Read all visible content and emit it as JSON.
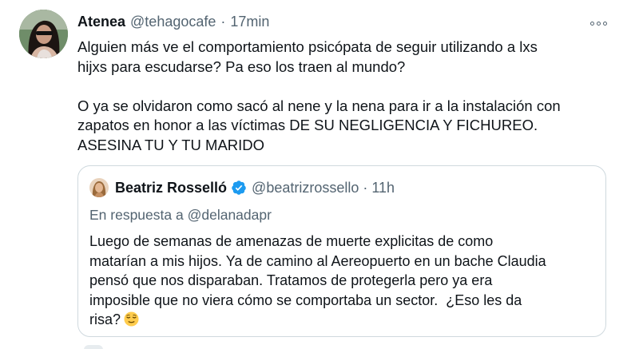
{
  "tweet": {
    "author_name": "Atenea",
    "author_handle": "@tehagocafe",
    "separator": "·",
    "time": "17min",
    "text": "Alguien más ve el comportamiento psicópata de seguir utilizando a lxs\nhijxs para escudarse? Pa eso los traen al mundo?\n\nO ya se olvidaron como sacó al nene y la nena para ir a la instalación con\nzapatos en honor a las víctimas DE SU NEGLIGENCIA Y FICHUREO.\nASESINA TU Y TU MARIDO"
  },
  "quoted": {
    "author_name": "Beatriz Rosselló",
    "author_handle": "@beatrizrossello",
    "separator": "·",
    "time": "11h",
    "reply_prefix": "En respuesta a",
    "reply_mention": "@delanadapr",
    "text": "Luego de semanas de amenazas de muerte explicitas de como\nmatarían a mis hijos. Ya de camino al Aereopuerto en un bache Claudia\npensó que nos disparaban. Tratamos de protegerla pero ya era\nimposible que no viera cómo se comportaba un sector.  ¿Eso les da\nrisa?",
    "emoji": "relieved-face-icon"
  },
  "colors": {
    "text": "#0f1419",
    "secondary": "#536471",
    "border": "#cfd9de",
    "verified": "#1d9bf0"
  }
}
